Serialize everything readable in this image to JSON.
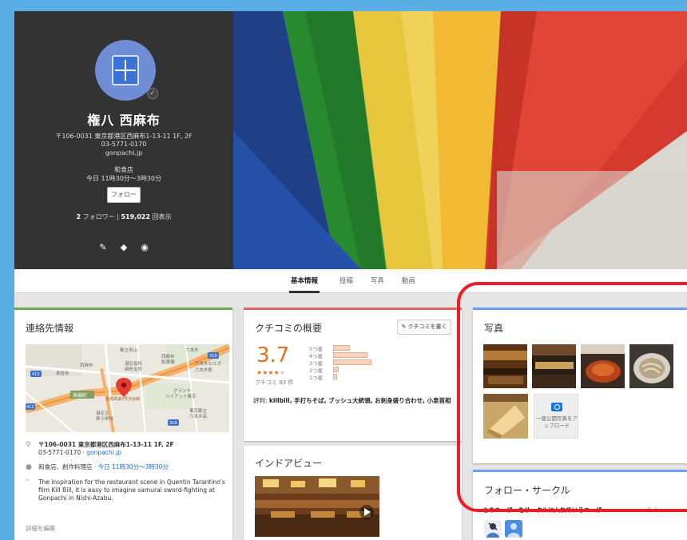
{
  "profile": {
    "name": "権八 西麻布",
    "address": "〒106-0031 東京都港区西麻布1-13-11 1F, 2F",
    "phone": "03-5771-0170",
    "website": "gonpachi.jp",
    "category": "和食店",
    "hours": "今日 11時30分～3時30分",
    "follow_label": "フォロー",
    "followers": "2",
    "followers_label": "フォロワー",
    "separator": "|",
    "views": "519,022",
    "views_label": "回表示"
  },
  "tabs": [
    {
      "label": "基本情報",
      "active": true
    },
    {
      "label": "投稿"
    },
    {
      "label": "写真"
    },
    {
      "label": "動画"
    }
  ],
  "contact": {
    "title": "連絡先情報",
    "address": "〒106-0031 東京都港区西麻布1-13-11 1F, 2F",
    "phone": "03-5771-0170",
    "phone_sep": " · ",
    "website": "gonpachi.jp",
    "categories": "和食店、創作料理店",
    "hours_sep": " · ",
    "hours": "今日 11時30分～3時30分",
    "description": "The inspiration for the restaurant scene in Quentin Tarantino's film Kill Bill, it is easy to imagine samurai sword-fighting at Gonpachi in Nishi-Azabu.",
    "edit_label": "詳細を編集"
  },
  "map": {
    "labels": [
      "都立青山",
      "六本木",
      "西麻布",
      "駐車場",
      "港区役所",
      "麻布支所",
      "長谷寺",
      "西麻布",
      "六本木ヒルズ",
      "六本木駅",
      "グランド",
      "ハイアット東京",
      "東京都立",
      "六本木高",
      "港区立",
      "笄小学校",
      "首都高速3号渋谷線"
    ],
    "road_badges": [
      "413",
      "412",
      "319",
      "319"
    ],
    "highlight_label": "高樹町"
  },
  "reviews": {
    "title": "クチコミの概要",
    "write_label": "クチコミを書く",
    "rating": "3.7",
    "stars": "★★★★",
    "stars_empty": "★",
    "count": "クチコミ 93 件",
    "distribution": [
      {
        "label": "5つ星",
        "fraction": 0.35
      },
      {
        "label": "4つ星",
        "fraction": 0.72
      },
      {
        "label": "3つ星",
        "fraction": 0.8
      },
      {
        "label": "2つ星",
        "fraction": 0.12
      },
      {
        "label": "1つ星",
        "fraction": 0.08
      }
    ],
    "summary_prefix": "評判: ",
    "summary": "killbill, 手打ちそば, ブッシュ大統領, お刺身盛り合わせ, 小泉首相"
  },
  "interior": {
    "title": "インドアビュー"
  },
  "photos": {
    "title": "写真",
    "upload_label": "一般公開写真をアップロード"
  },
  "circles": {
    "title": "フォロー・サークル",
    "text": "このユーザーをサークルに入れているユーザー",
    "count": "2 人"
  },
  "colors": {
    "contact_accent": "#6aa84f",
    "reviews_accent": "#e06666",
    "photos_accent": "#6d9eeb",
    "highlight": "#ee1c25",
    "sky": "#5aaee6"
  }
}
